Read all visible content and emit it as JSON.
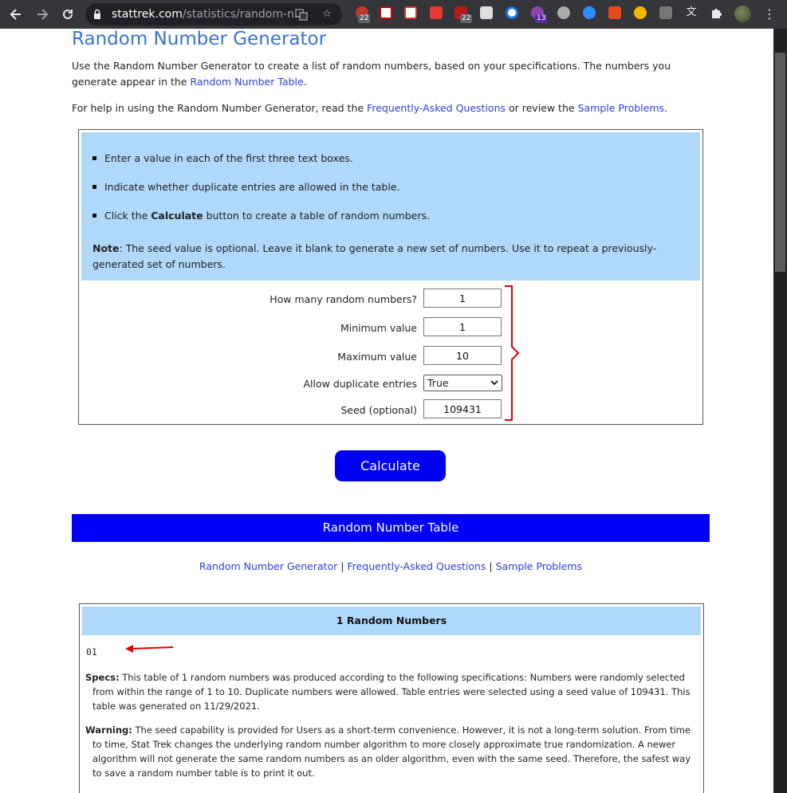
{
  "browser": {
    "url_host": "stattrek.com",
    "url_path": "/statistics/random-n...",
    "extension_badges": [
      "22",
      "22",
      "13"
    ]
  },
  "page": {
    "title": "Random Number Generator",
    "intro_1a": "Use the Random Number Generator to create a list of random numbers, based on your specifications. The numbers you generate appear in the ",
    "intro_1_link": "Random Number Table",
    "intro_1b": ".",
    "intro_2a": "For help in using the Random Number Generator, read the ",
    "intro_2_link1": "Frequently-Asked Questions",
    "intro_2b": " or review the ",
    "intro_2_link2": "Sample Problems",
    "intro_2c": "."
  },
  "instructions": {
    "bullet_1": "Enter a value in each of the first three text boxes.",
    "bullet_2": "Indicate whether duplicate entries are allowed in the table.",
    "bullet_3a": "Click the ",
    "bullet_3_bold": "Calculate",
    "bullet_3b": " button to create a table of random numbers.",
    "note_label": "Note",
    "note_text": ": The seed value is optional. Leave it blank to generate a new set of numbers. Use it to repeat a previously-generated set of numbers."
  },
  "form": {
    "count_label": "How many random numbers?",
    "count_value": "1",
    "min_label": "Minimum value",
    "min_value": "1",
    "max_label": "Maximum value",
    "max_value": "10",
    "duplicates_label": "Allow duplicate entries",
    "duplicates_value": "True",
    "seed_label": "Seed (optional)",
    "seed_value": "109431",
    "calculate_label": "Calculate"
  },
  "table_banner": "Random Number Table",
  "nav": {
    "link_1": "Random Number Generator",
    "sep": " | ",
    "link_2": "Frequently-Asked Questions",
    "link_3": "Sample Problems"
  },
  "results": {
    "heading": "1 Random Numbers",
    "number": "01",
    "specs_label": "Specs:",
    "specs_text": " This table of 1 random numbers was produced according to the following specifications: Numbers were randomly selected from within the range of 1 to 10. Duplicate numbers were allowed. Table entries were selected using a seed value of 109431. This table was generated on 11/29/2021.",
    "warning_label": "Warning:",
    "warning_text": " The seed capability is provided for Users as a short-term convenience. However, it is not a long-term solution. From time to time, Stat Trek changes the underlying random number algorithm to more closely approximate true randomization. A newer algorithm will not generate the same random numbers as an older algorithm, even with the same seed. Therefore, the safest way to save a random number table is to print it out."
  },
  "colors": {
    "title": "#3a73d6",
    "link": "#2a3fd9",
    "panel": "#b0d8fb",
    "button": "#0000f0",
    "annotation": "#e00000"
  }
}
